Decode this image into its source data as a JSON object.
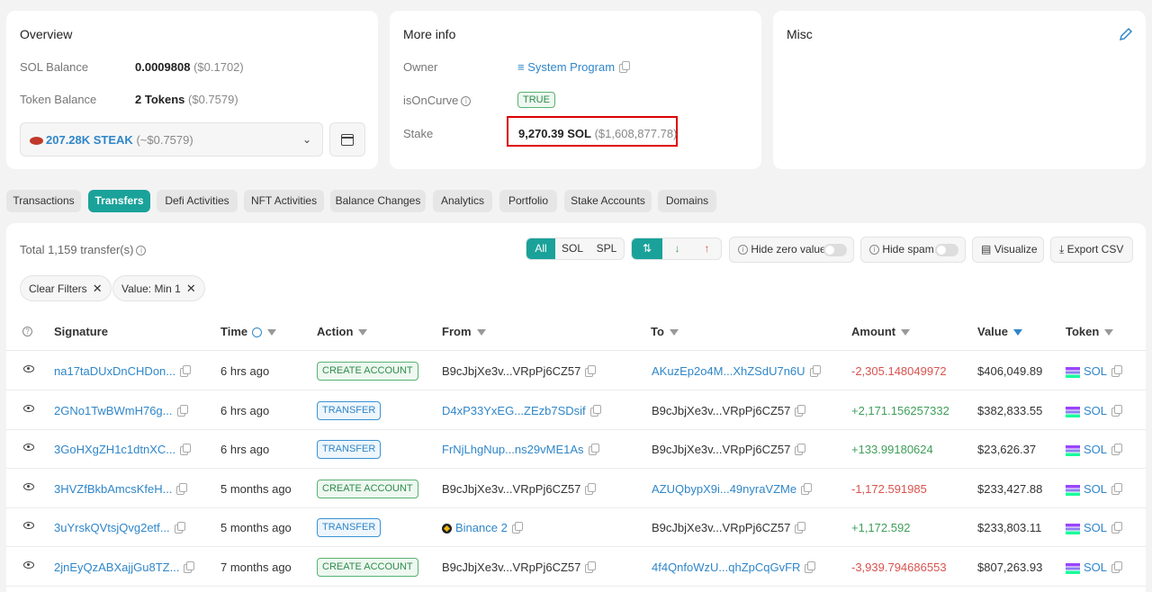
{
  "overview": {
    "title": "Overview",
    "sol_balance_label": "SOL Balance",
    "sol_balance_value": "0.0009808",
    "sol_balance_usd": "($0.1702)",
    "token_balance_label": "Token Balance",
    "token_balance_value": "2 Tokens",
    "token_balance_usd": "($0.7579)",
    "token_select_amount": "207.28K STEAK",
    "token_select_usd": "(~$0.7579)"
  },
  "more_info": {
    "title": "More info",
    "owner_label": "Owner",
    "owner_value": "System Program",
    "curve_label": "isOnCurve",
    "curve_value": "TRUE",
    "stake_label": "Stake",
    "stake_value": "9,270.39 SOL",
    "stake_usd": "($1,608,877.78)"
  },
  "misc": {
    "title": "Misc"
  },
  "tabs": [
    "Transactions",
    "Transfers",
    "Defi Activities",
    "NFT Activities",
    "Balance Changes",
    "Analytics",
    "Portfolio",
    "Stake Accounts",
    "Domains"
  ],
  "toolbar": {
    "total": "Total 1,159 transfer(s)",
    "filter_all": "All",
    "filter_sol": "SOL",
    "filter_spl": "SPL",
    "hide_zero": "Hide zero value",
    "hide_spam": "Hide spam",
    "visualize": "Visualize",
    "export": "Export CSV"
  },
  "chips": {
    "clear": "Clear Filters",
    "value": "Value: Min 1"
  },
  "columns": {
    "signature": "Signature",
    "time": "Time",
    "action": "Action",
    "from": "From",
    "to": "To",
    "amount": "Amount",
    "value": "Value",
    "token": "Token"
  },
  "rows": [
    {
      "sig": "na17taDUxDnCHDon...",
      "time": "6 hrs ago",
      "action": "CREATE ACCOUNT",
      "from": "B9cJbjXe3v...VRpPj6CZ57",
      "to": "AKuzEp2o4M...XhZSdU7n6U",
      "amount": "-2,305.148049972",
      "value": "$406,049.89",
      "token": "SOL"
    },
    {
      "sig": "2GNo1TwBWmH76g...",
      "time": "6 hrs ago",
      "action": "TRANSFER",
      "from": "D4xP33YxEG...ZEzb7SDsif",
      "to": "B9cJbjXe3v...VRpPj6CZ57",
      "amount": "+2,171.156257332",
      "value": "$382,833.55",
      "token": "SOL"
    },
    {
      "sig": "3GoHXgZH1c1dtnXC...",
      "time": "6 hrs ago",
      "action": "TRANSFER",
      "from": "FrNjLhgNup...ns29vME1As",
      "to": "B9cJbjXe3v...VRpPj6CZ57",
      "amount": "+133.99180624",
      "value": "$23,626.37",
      "token": "SOL"
    },
    {
      "sig": "3HVZfBkbAmcsKfeH...",
      "time": "5 months ago",
      "action": "CREATE ACCOUNT",
      "from": "B9cJbjXe3v...VRpPj6CZ57",
      "to": "AZUQbypX9i...49nyraVZMe",
      "amount": "-1,172.591985",
      "value": "$233,427.88",
      "token": "SOL"
    },
    {
      "sig": "3uYrskQVtsjQvg2etf...",
      "time": "5 months ago",
      "action": "TRANSFER",
      "from": "Binance 2",
      "to": "B9cJbjXe3v...VRpPj6CZ57",
      "amount": "+1,172.592",
      "value": "$233,803.11",
      "token": "SOL"
    },
    {
      "sig": "2jnEyQzABXajjGu8TZ...",
      "time": "7 months ago",
      "action": "CREATE ACCOUNT",
      "from": "B9cJbjXe3v...VRpPj6CZ57",
      "to": "4f4QnfoWzU...qhZpCqGvFR",
      "amount": "-3,939.794686553",
      "value": "$807,263.93",
      "token": "SOL"
    }
  ]
}
